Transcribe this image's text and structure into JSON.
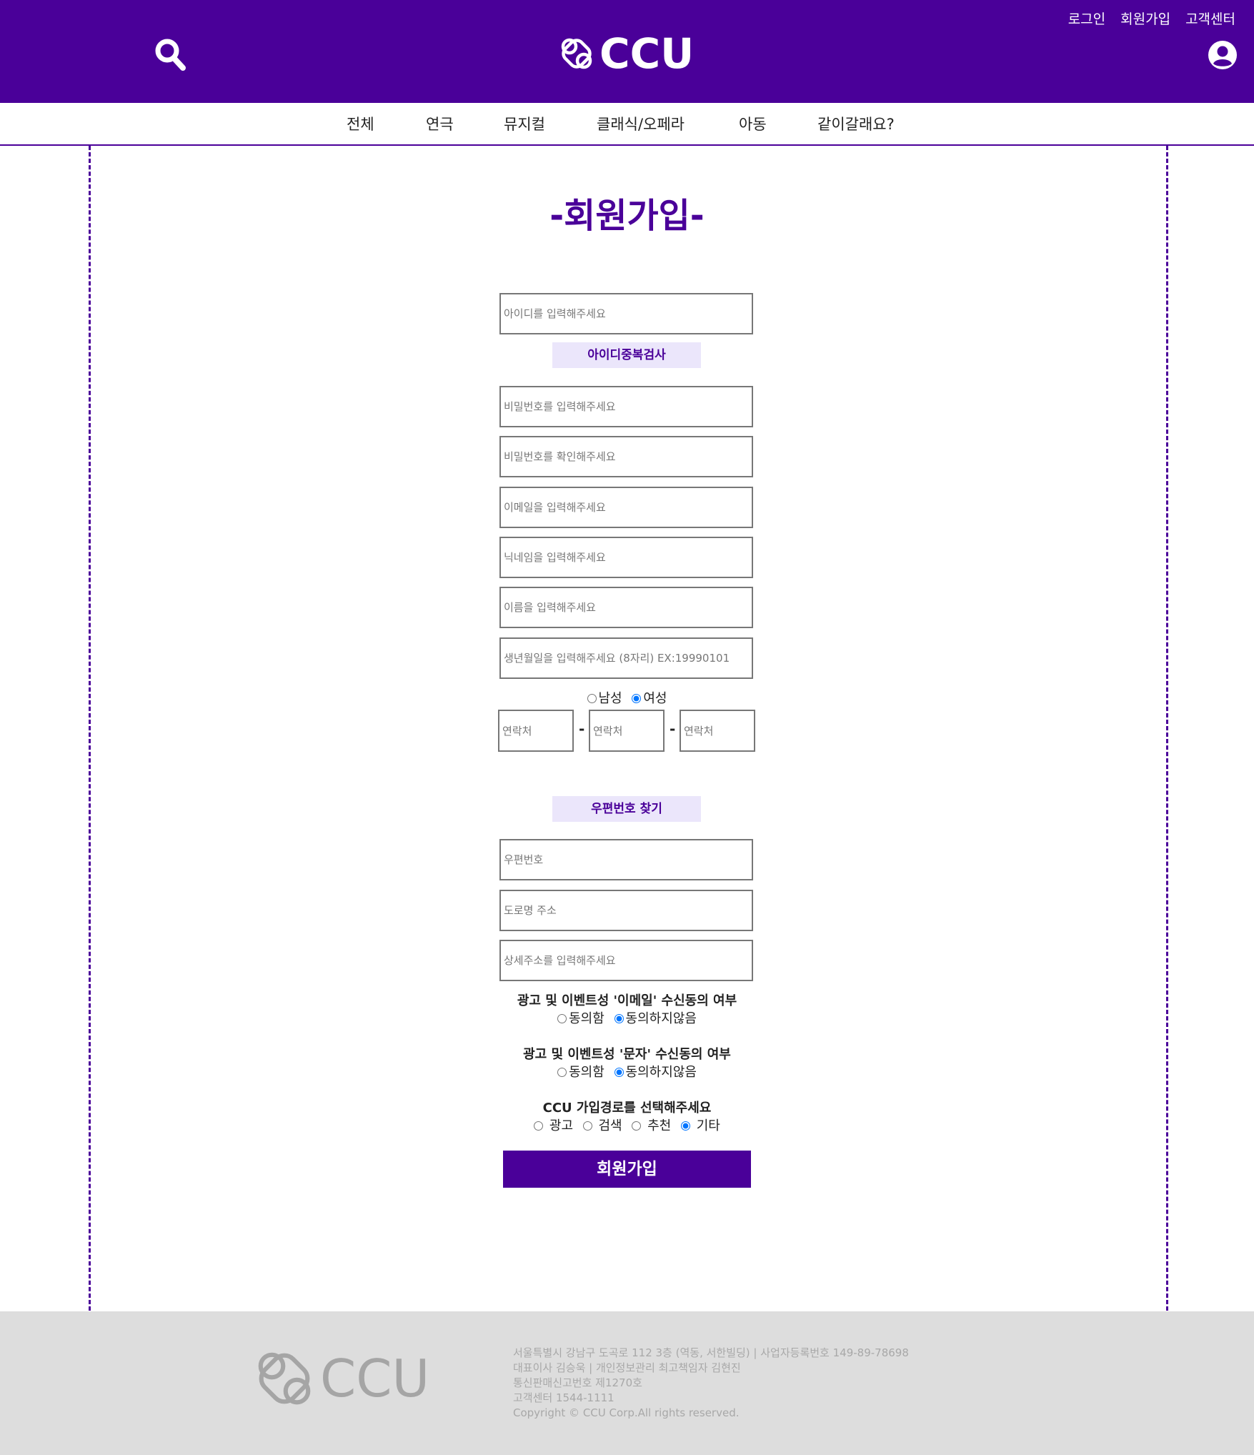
{
  "header": {
    "top_links": [
      "로그인",
      "회원가입",
      "고객센터"
    ],
    "logo_text": "CCU",
    "search_icon": "search-icon",
    "user_icon": "user-circle-icon"
  },
  "nav": {
    "items": [
      "전체",
      "연극",
      "뮤지컬",
      "클래식/오페라",
      "아동",
      "같이갈래요?"
    ]
  },
  "form": {
    "title": "-회원가입-",
    "id_placeholder": "아이디를 입력해주세요",
    "id_check_button": "아이디중복검사",
    "password_placeholder": "비밀번호를 입력해주세요",
    "password_confirm_placeholder": "비밀번호를 확인해주세요",
    "email_placeholder": "이메일을 입력해주세요",
    "nickname_placeholder": "닉네임을 입력해주세요",
    "name_placeholder": "이름을 입력해주세요",
    "birth_placeholder": "생년월일을 입력해주세요 (8자리) EX:19990101",
    "gender": {
      "male": "남성",
      "female": "여성",
      "selected": "여성"
    },
    "phone_placeholder": "연락처",
    "phone_separator": "-",
    "zip_search_button": "우편번호 찾기",
    "zip_placeholder": "우편번호",
    "road_address_placeholder": "도로명 주소",
    "detail_address_placeholder": "상세주소를 입력해주세요",
    "email_agree": {
      "title": "광고 및 이벤트성 '이메일' 수신동의 여부",
      "agree": "동의함",
      "disagree": "동의하지않음",
      "selected": "동의하지않음"
    },
    "sms_agree": {
      "title": "광고 및 이벤트성 '문자' 수신동의 여부",
      "agree": "동의함",
      "disagree": "동의하지않음",
      "selected": "동의하지않음"
    },
    "join_path": {
      "title": "CCU 가입경로를 선택해주세요",
      "options": [
        "광고",
        "검색",
        "추천",
        "기타"
      ],
      "selected": "기타"
    },
    "submit_label": "회원가입"
  },
  "footer": {
    "logo_text": "CCU",
    "lines": [
      "서울특별시 강남구 도곡로 112 3층 (역동, 서한빌딩) | 사업자등록번호 149-89-78698",
      "대표이사 김승욱 | 개인정보관리 최고책임자 김현진",
      "통신판매신고번호 제1270호",
      "고객센터 1544-1111",
      "Copyright © CCU Corp.All rights reserved."
    ]
  },
  "colors": {
    "brand": "#4a0099",
    "button_light": "#ebe6fb",
    "footer_bg": "#dddddd",
    "footer_text": "#a8a8a8"
  }
}
